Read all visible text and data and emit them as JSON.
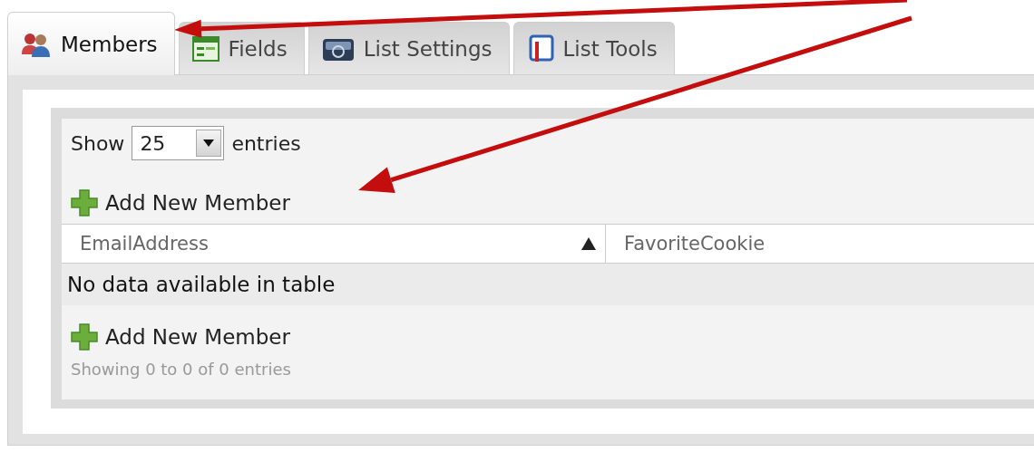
{
  "tabs": [
    {
      "label": "Members",
      "selected": true
    },
    {
      "label": "Fields",
      "selected": false
    },
    {
      "label": "List Settings",
      "selected": false
    },
    {
      "label": "List Tools",
      "selected": false
    }
  ],
  "length_control": {
    "prefix": "Show",
    "value": "25",
    "suffix": "entries"
  },
  "add_links": [
    "Add New Member",
    "Add New Member"
  ],
  "table": {
    "columns": [
      {
        "label": "EmailAddress",
        "sorted": true
      },
      {
        "label": "FavoriteCookie",
        "sorted": false
      }
    ],
    "empty_message": "No data available in table"
  },
  "info": "Showing 0 to 0 of 0 entries",
  "annotations": [
    {
      "kind": "arrow"
    },
    {
      "kind": "arrow"
    }
  ]
}
